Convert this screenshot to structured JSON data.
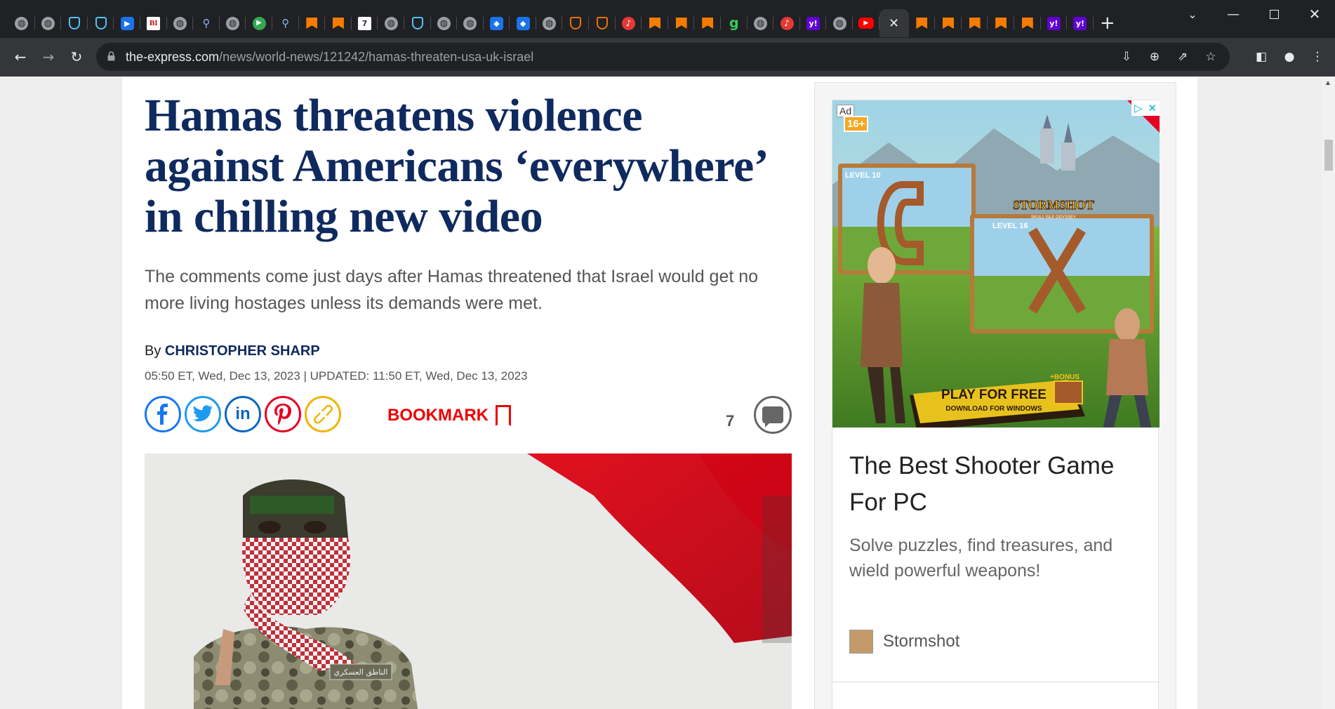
{
  "browser": {
    "tab_favicons": [
      "globe",
      "globe",
      "shield",
      "shield",
      "arrow",
      "bi",
      "globe",
      "search",
      "globe",
      "play",
      "search",
      "bookmark",
      "bookmark",
      "doc",
      "globe",
      "shield",
      "globe",
      "globe",
      "cube",
      "cube",
      "globe",
      "ublock",
      "ublock",
      "podcast",
      "bookmark",
      "bookmark",
      "bookmark",
      "grammarly",
      "globe",
      "podcast",
      "yahoo",
      "globe",
      "youtube",
      "active-close",
      "bookmark",
      "bookmark",
      "bookmark",
      "bookmark",
      "bookmark",
      "yahoo",
      "yahoo"
    ],
    "url_host": "the-express.com",
    "url_path": "/news/world-news/121242/hamas-threaten-usa-uk-israel"
  },
  "article": {
    "headline": "Hamas threatens violence against Americans ‘everywhere’ in chilling new video",
    "standfirst": "The comments come just days after Hamas threatened that Israel would get no more living hostages unless its demands were met.",
    "byline_prefix": "By ",
    "author": "CHRISTOPHER SHARP",
    "dateline": "05:50 ET, Wed, Dec 13, 2023 | UPDATED: 11:50 ET, Wed, Dec 13, 2023",
    "bookmark_label": "BOOKMARK",
    "comment_count": "7",
    "share_colors": {
      "facebook": "#1877f2",
      "twitter": "#1d9bf0",
      "linkedin": "#0a66c2",
      "pinterest": "#e60023",
      "link": "#f0b400"
    },
    "hero_overlay_text": "الناطق العسكري"
  },
  "ad": {
    "label": "Ad",
    "age_rating": "16+",
    "level_left": "LEVEL 10",
    "level_right": "LEVEL 16",
    "game_logo": "STORMSHOT",
    "game_logo_sub": "SKULL ISLE ODYSSEY",
    "cta_bonus": "+BONUS",
    "cta_main": "PLAY FOR FREE",
    "cta_sub": "DOWNLOAD FOR WINDOWS",
    "title": "The Best Shooter Game For PC",
    "description": "Solve puzzles, find treasures, and wield powerful weapons!",
    "brand": "Stormshot"
  }
}
